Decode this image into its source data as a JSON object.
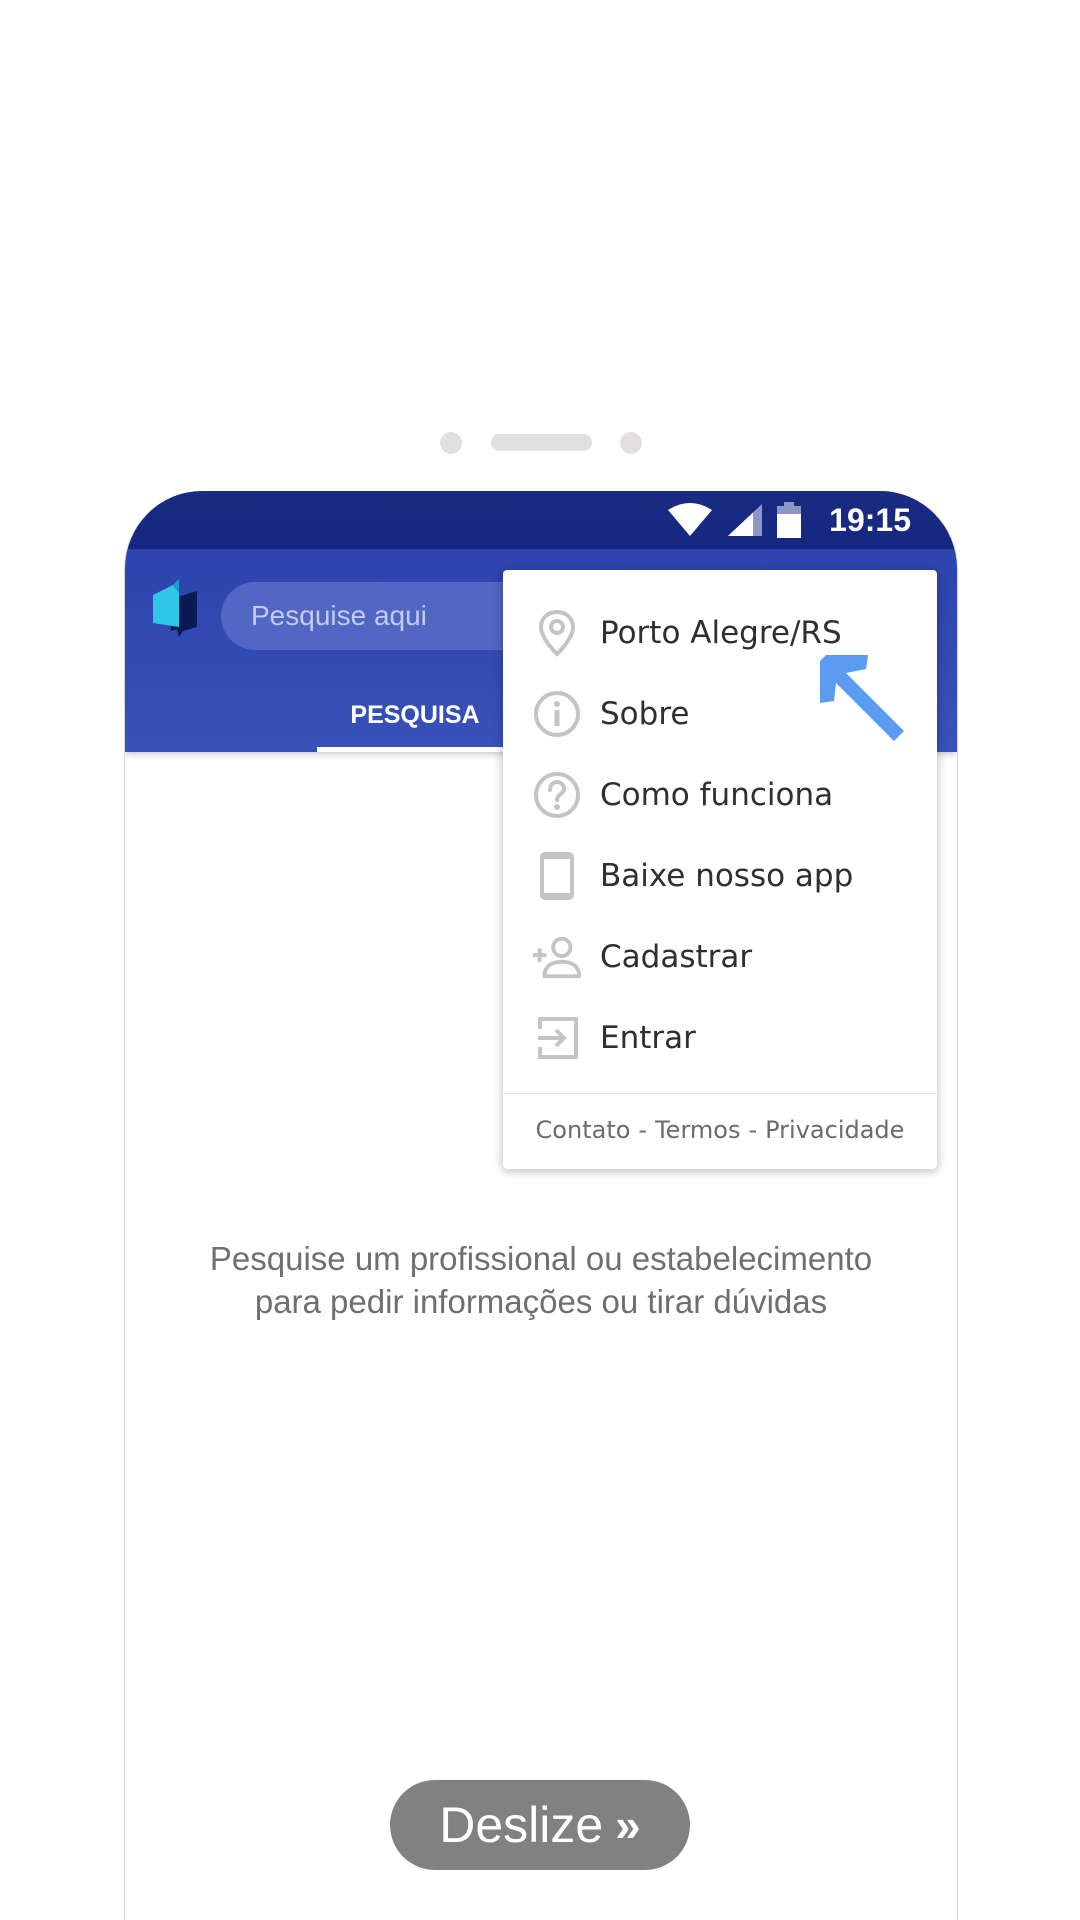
{
  "statusbar": {
    "time": "19:15"
  },
  "appbar": {
    "search": {
      "placeholder": "Pesquise aqui"
    },
    "tab_active": "PESQUISA"
  },
  "main": {
    "hint_line1": "Pesquise um profissional ou estabelecimento",
    "hint_line2": "para pedir informações ou tirar dúvidas"
  },
  "menu": {
    "items": [
      {
        "label": "Porto Alegre/RS",
        "icon": "location-pin-icon"
      },
      {
        "label": "Sobre",
        "icon": "info-icon"
      },
      {
        "label": "Como funciona",
        "icon": "help-icon"
      },
      {
        "label": "Baixe nosso app",
        "icon": "smartphone-icon"
      },
      {
        "label": "Cadastrar",
        "icon": "add-user-icon"
      },
      {
        "label": "Entrar",
        "icon": "login-icon"
      }
    ],
    "footer": {
      "contact": "Contato",
      "terms": "Termos",
      "privacy": "Privacidade",
      "separator": "-"
    }
  },
  "swipe_button": {
    "label": "Deslize",
    "chevron": "»"
  },
  "colors": {
    "statusbar": "#1b2a82",
    "appbar": "#3149b1",
    "accent_arrow": "#5b9cf2",
    "icon_gray": "#c4c4c4"
  }
}
